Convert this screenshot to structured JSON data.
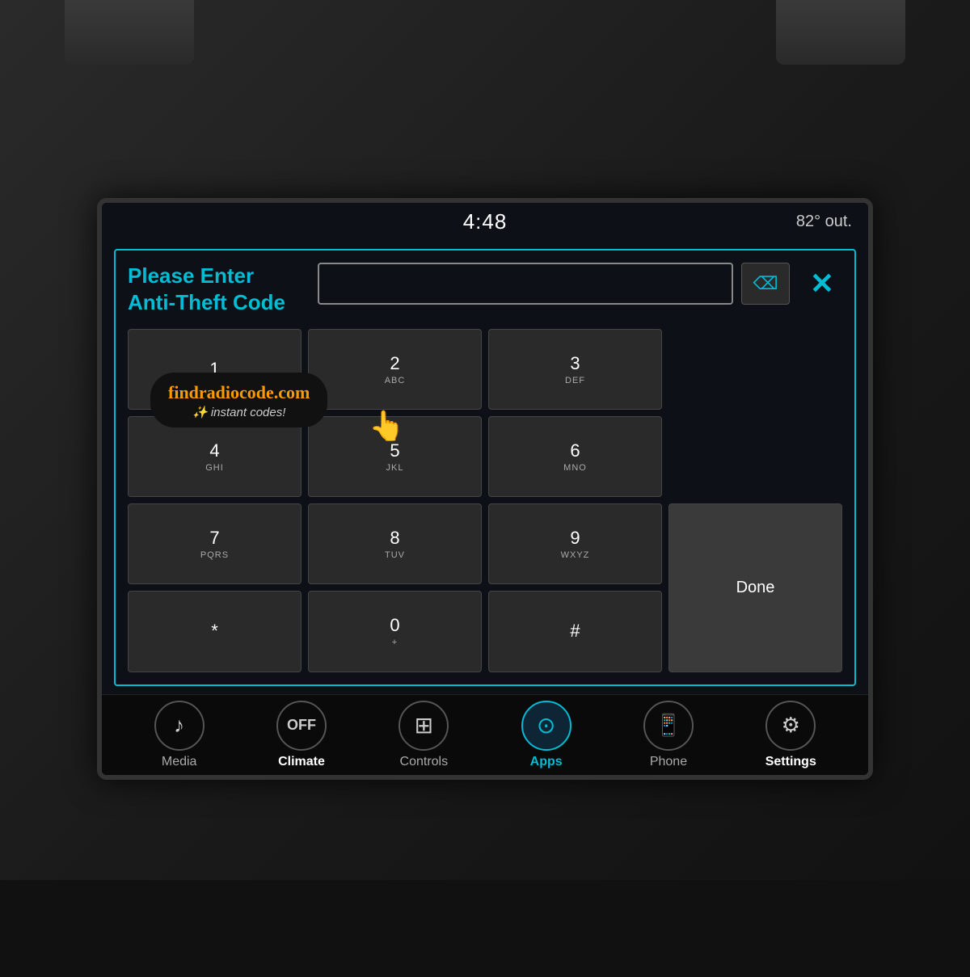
{
  "statusBar": {
    "time": "4:48",
    "temperature": "82° out."
  },
  "dialog": {
    "title_line1": "Please Enter",
    "title_line2": "Anti-Theft Code",
    "inputValue": "",
    "inputPlaceholder": "",
    "backspaceLabel": "⌫",
    "closeLabel": "✕"
  },
  "keypad": [
    {
      "display": "1",
      "sub": "",
      "id": "1"
    },
    {
      "display": "2",
      "sub": "ABC",
      "id": "2"
    },
    {
      "display": "3",
      "sub": "DEF",
      "id": "3"
    },
    {
      "display": "4",
      "sub": "GHI",
      "id": "4"
    },
    {
      "display": "5",
      "sub": "JKL",
      "id": "5"
    },
    {
      "display": "6",
      "sub": "MNO",
      "id": "6"
    },
    {
      "display": "7",
      "sub": "PQRS",
      "id": "7"
    },
    {
      "display": "8",
      "sub": "TUV",
      "id": "8"
    },
    {
      "display": "9",
      "sub": "WXYZ",
      "id": "9"
    },
    {
      "display": "*",
      "sub": "",
      "id": "star"
    },
    {
      "display": "0",
      "sub": "+",
      "id": "0"
    },
    {
      "display": "#",
      "sub": "",
      "id": "hash"
    }
  ],
  "doneButton": "Done",
  "navBar": {
    "items": [
      {
        "icon": "♪",
        "label": "Media",
        "active": false
      },
      {
        "icon": "OFF",
        "label": "Climate",
        "active": false,
        "iconText": true
      },
      {
        "icon": "⊕",
        "label": "Controls",
        "active": false,
        "controlsIcon": true
      },
      {
        "icon": "û",
        "label": "Apps",
        "active": true
      },
      {
        "icon": "☐",
        "label": "Phone",
        "active": false
      },
      {
        "icon": "⚙",
        "label": "Settings",
        "active": false
      }
    ]
  },
  "watermark": {
    "url": "findradiocode.com",
    "tagline": "instant codes!"
  }
}
